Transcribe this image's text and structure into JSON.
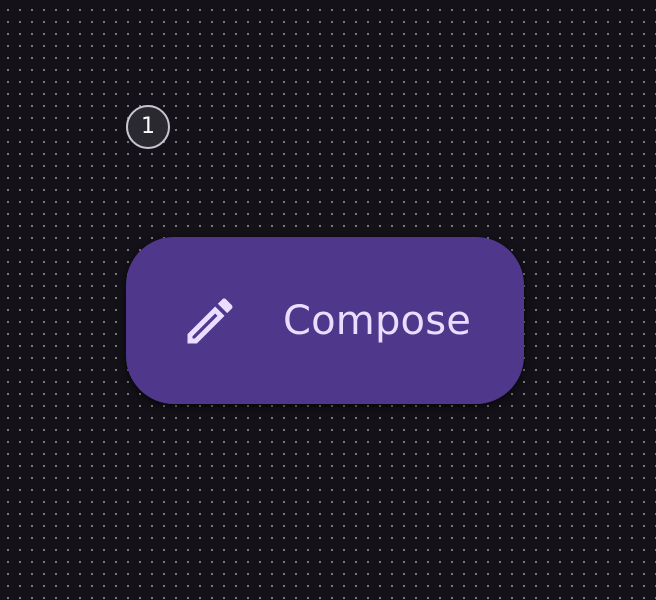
{
  "marker": {
    "label": "1"
  },
  "fab": {
    "label": "Compose",
    "icon": "pencil-icon",
    "container_color": "#4f378b",
    "content_color": "#eaddff"
  },
  "background": {
    "color": "#141218",
    "pattern": "dot-grid"
  }
}
